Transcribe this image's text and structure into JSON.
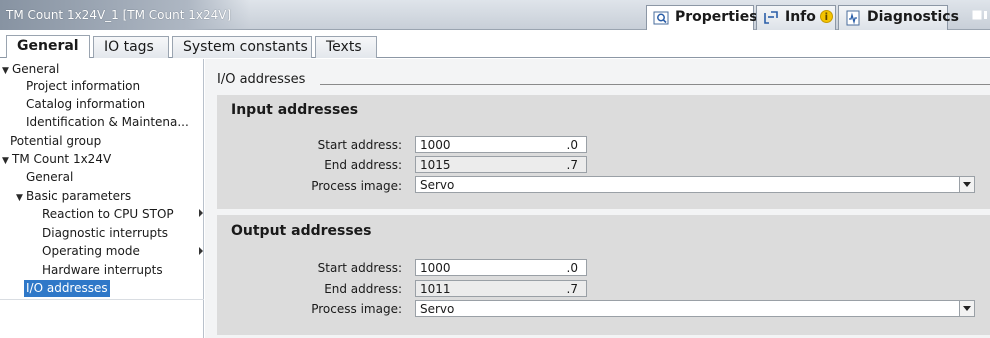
{
  "window": {
    "title": "TM Count 1x24V_1 [TM Count 1x24V]"
  },
  "inspector_tabs": [
    {
      "label": "Properties",
      "icon": "properties-icon"
    },
    {
      "label": "Info",
      "icon": "info-icon",
      "badge": "i"
    },
    {
      "label": "Diagnostics",
      "icon": "diagnostics-icon"
    }
  ],
  "tabs": [
    {
      "label": "General"
    },
    {
      "label": "IO tags"
    },
    {
      "label": "System constants"
    },
    {
      "label": "Texts"
    }
  ],
  "nav": {
    "items": [
      {
        "label": "General",
        "expanded": true
      },
      {
        "label": "Project information"
      },
      {
        "label": "Catalog information"
      },
      {
        "label": "Identification & Maintena..."
      },
      {
        "label": "Potential group"
      },
      {
        "label": "TM Count 1x24V",
        "expanded": true
      },
      {
        "label": "General"
      },
      {
        "label": "Basic parameters",
        "expanded": true
      },
      {
        "label": "Reaction to CPU STOP"
      },
      {
        "label": "Diagnostic interrupts"
      },
      {
        "label": "Operating mode"
      },
      {
        "label": "Hardware interrupts"
      },
      {
        "label": "I/O addresses",
        "selected": true
      }
    ]
  },
  "main": {
    "section_title": "I/O addresses",
    "input": {
      "title": "Input addresses",
      "start_label": "Start address:",
      "start_value": "1000",
      "start_bit": ".0",
      "end_label": "End address:",
      "end_value": "1015",
      "end_bit": ".7",
      "process_label": "Process image:",
      "process_value": "Servo"
    },
    "output": {
      "title": "Output addresses",
      "start_label": "Start address:",
      "start_value": "1000",
      "start_bit": ".0",
      "end_label": "End address:",
      "end_value": "1011",
      "end_bit": ".7",
      "process_label": "Process image:",
      "process_value": "Servo"
    }
  },
  "colors": {
    "selection": "#2f78c8",
    "panel": "#dcdcdc",
    "title_bar": "#8793a2"
  }
}
